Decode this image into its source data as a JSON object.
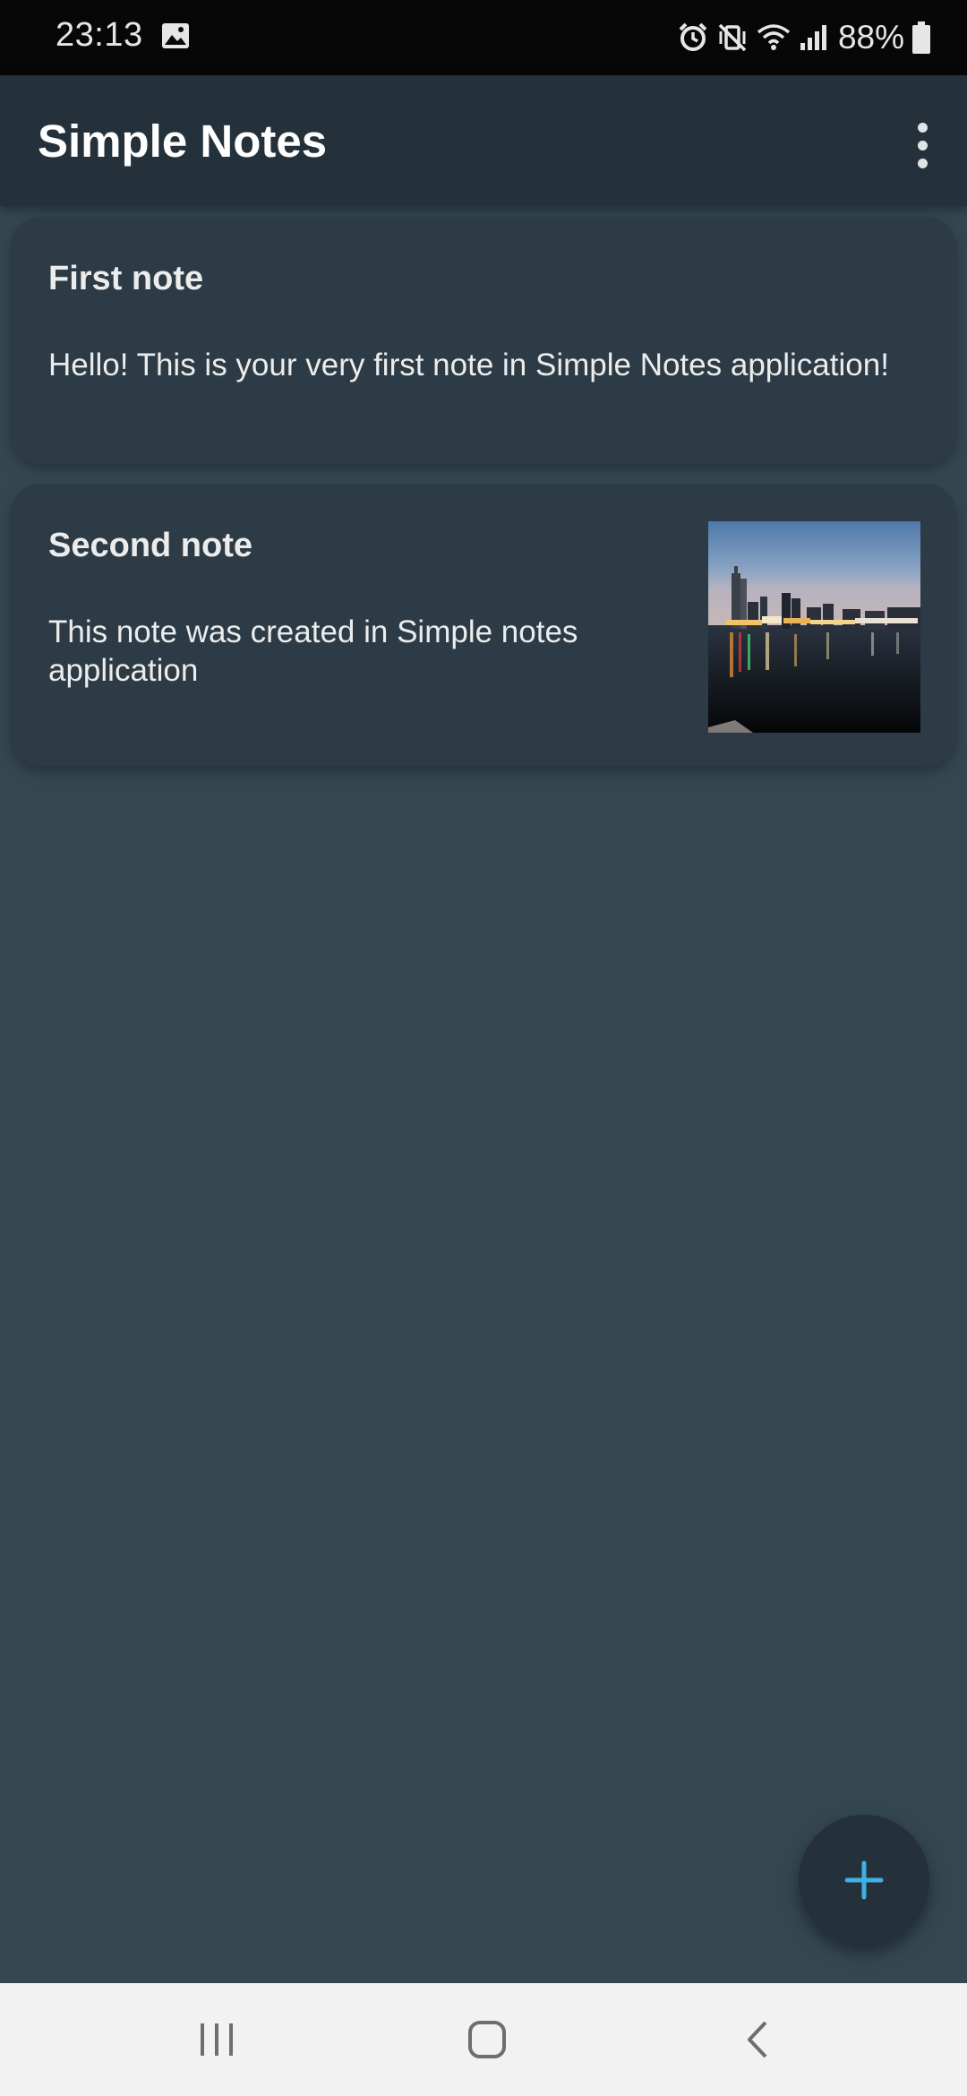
{
  "status_bar": {
    "time": "23:13",
    "battery_percent": "88%",
    "icons": [
      "gallery-icon",
      "alarm-icon",
      "vibrate-mute-icon",
      "wifi-icon",
      "signal-icon",
      "battery-icon"
    ]
  },
  "app_bar": {
    "title": "Simple Notes",
    "menu_icon": "more-vert-icon"
  },
  "notes": [
    {
      "title": "First note",
      "body": "Hello! This is your very first note in Simple Notes application!",
      "has_image": false
    },
    {
      "title": "Second note",
      "body": "This note was created in Simple notes application",
      "has_image": true,
      "image_icon": "city-skyline-thumbnail"
    }
  ],
  "fab": {
    "icon": "add-icon"
  },
  "nav_bar": {
    "icons": [
      "recents-icon",
      "home-icon",
      "back-icon"
    ]
  },
  "colors": {
    "background": "#344751",
    "app_bar": "#25313a",
    "card": "#2c3b45",
    "text": "#ececec",
    "accent": "#3fb0e6"
  }
}
